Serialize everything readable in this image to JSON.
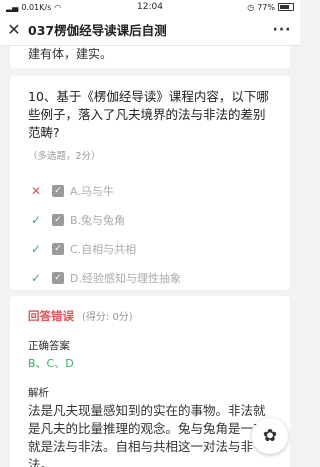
{
  "status_bar": {
    "left": "0.01K/s",
    "time": "12:04",
    "battery": "77%"
  },
  "nav": {
    "close_icon": "close-icon",
    "title": "037楞伽经导读课后自测",
    "more": "···"
  },
  "prev_question": {
    "tail_text": "建有体，建实。"
  },
  "question": {
    "text": "10、基于《楞伽经导读》课程内容，以下哪些例子，落入了凡夫境界的法与非法的差别范畴?",
    "meta": "（多选题，2分）",
    "options": [
      {
        "label": "A.马与牛",
        "mark": "✕",
        "status": "wrong"
      },
      {
        "label": "B.兔与兔角",
        "mark": "✓",
        "status": "right"
      },
      {
        "label": "C.自相与共相",
        "mark": "✓",
        "status": "right"
      },
      {
        "label": "D.经验感知与理性抽象",
        "mark": "✓",
        "status": "right"
      }
    ]
  },
  "answer": {
    "result": "回答错误",
    "score": "(得分: 0分)",
    "correct_label": "正确答案",
    "correct_value": "B、C、D",
    "analysis_label": "解析",
    "analysis_text": "法是凡夫现量感知到的实在的事物。非法就是凡夫的比量推理的观念。兔与兔角是一对就是法与非法。自相与共相这一对法与非法。"
  },
  "colors": {
    "wrong": "#e05454",
    "right": "#2fb46a"
  },
  "float_button": {
    "icon": "flower-menu-icon",
    "glyph": "✿"
  }
}
